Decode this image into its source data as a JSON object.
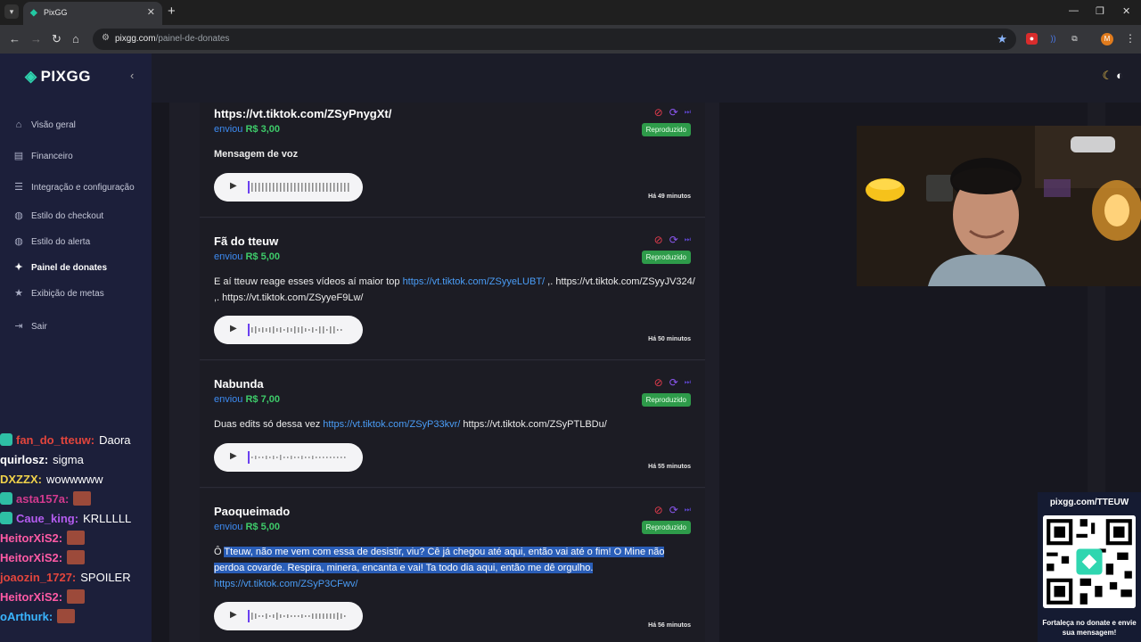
{
  "browser": {
    "tab_title": "PixGG",
    "url_domain": "pixgg.com",
    "url_path": "/painel-de-donates",
    "avatar_letter": "M"
  },
  "app": {
    "logo": "PIXGG",
    "sidebar": [
      {
        "label": "Visão geral",
        "icon": "home-icon"
      },
      {
        "label": "Financeiro",
        "icon": "wallet-icon"
      },
      {
        "label": "Integração e configuração",
        "icon": "integration-icon"
      },
      {
        "label": "Estilo do checkout",
        "icon": "palette-icon"
      },
      {
        "label": "Estilo do alerta",
        "icon": "palette-icon"
      },
      {
        "label": "Painel de donates",
        "icon": "gift-icon"
      },
      {
        "label": "Exibição de metas",
        "icon": "star-icon"
      },
      {
        "label": "Sair",
        "icon": "logout-icon"
      }
    ],
    "active_item": "Painel de donates"
  },
  "donates": [
    {
      "name": "https://vt.tiktok.com/ZSyPnygXt/",
      "sent_label": "enviou",
      "amount": "R$ 3,00",
      "status": "Reproduzido",
      "message": "Mensagem de voz",
      "time": "Há 49 minutos"
    },
    {
      "name": "Fã do tteuw",
      "sent_label": "enviou",
      "amount": "R$ 5,00",
      "status": "Reproduzido",
      "message_pre": "E aí tteuw reage esses vídeos aí maior top ",
      "message_link": "https://vt.tiktok.com/ZSyyeLUBT/",
      "message_post": " ,. https://vt.tiktok.com/ZSyyJV324/ ,. https://vt.tiktok.com/ZSyyeF9Lw/",
      "time": "Há 50 minutos"
    },
    {
      "name": "Nabunda",
      "sent_label": "enviou",
      "amount": "R$ 7,00",
      "status": "Reproduzido",
      "message_pre": "Duas edits só dessa vez ",
      "message_link": "https://vt.tiktok.com/ZSyP33kvr/",
      "message_post": " https://vt.tiktok.com/ZSyPTLBDu/",
      "time": "Há 55 minutos"
    },
    {
      "name": "Paoqueimado",
      "sent_label": "enviou",
      "amount": "R$ 5,00",
      "status": "Reproduzido",
      "message_pre": "Ô ",
      "message_highlight": "Tteuw, não me vem com essa de desistir, viu? Cê já chegou até aqui, então vai até o fim! O Mine não perdoa covarde. Respira, minera, encanta e vai! Ta todo dia aqui, então me dê orgulho.",
      "message_link": "https://vt.tiktok.com/ZSyP3CFwv/",
      "time": "Há 56 minutos"
    }
  ],
  "qr": {
    "title": "pixgg.com/TTEUW",
    "caption": "Fortaleça no donate e envie sua mensagem!"
  },
  "chat": [
    {
      "user": "fan_do_tteuw:",
      "color": "#e2453c",
      "msg": "Daora"
    },
    {
      "user": "quirlosz:",
      "color": "#ffffff",
      "msg": "sigma"
    },
    {
      "user": "DXZZX:",
      "color": "#f0d24a",
      "msg": "wowwwww"
    },
    {
      "user": "asta157a:",
      "color": "#d23a8e",
      "msg": ""
    },
    {
      "user": "Caue_king:",
      "color": "#b45cf0",
      "msg": "KRLLLLL"
    },
    {
      "user": "HeitorXiS2:",
      "color": "#ff5aa5",
      "msg": ""
    },
    {
      "user": "HeitorXiS2:",
      "color": "#ff5aa5",
      "msg": ""
    },
    {
      "user": "joaozin_1727:",
      "color": "#e2453c",
      "msg": "SPOILER"
    },
    {
      "user": "HeitorXiS2:",
      "color": "#ff5aa5",
      "msg": ""
    },
    {
      "user": "oArthurk:",
      "color": "#3ab5ff",
      "msg": ""
    }
  ]
}
